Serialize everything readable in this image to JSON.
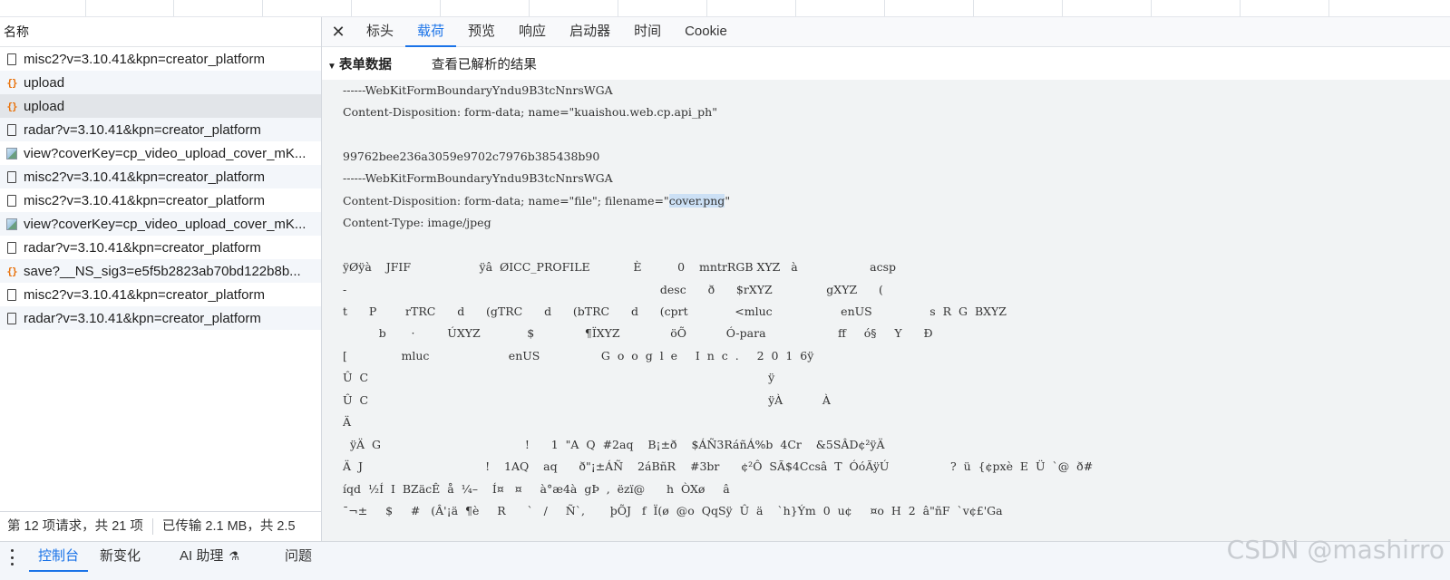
{
  "left": {
    "header": "名称",
    "requests": [
      {
        "icon": "doc",
        "name": "misc2?v=3.10.41&kpn=creator_platform"
      },
      {
        "icon": "xhr",
        "name": "upload"
      },
      {
        "icon": "xhr",
        "name": "upload"
      },
      {
        "icon": "doc",
        "name": "radar?v=3.10.41&kpn=creator_platform"
      },
      {
        "icon": "img",
        "name": "view?coverKey=cp_video_upload_cover_mK..."
      },
      {
        "icon": "doc",
        "name": "misc2?v=3.10.41&kpn=creator_platform"
      },
      {
        "icon": "doc",
        "name": "misc2?v=3.10.41&kpn=creator_platform"
      },
      {
        "icon": "img",
        "name": "view?coverKey=cp_video_upload_cover_mK..."
      },
      {
        "icon": "doc",
        "name": "radar?v=3.10.41&kpn=creator_platform"
      },
      {
        "icon": "xhr",
        "name": "save?__NS_sig3=e5f5b2823ab70bd122b8b..."
      },
      {
        "icon": "doc",
        "name": "misc2?v=3.10.41&kpn=creator_platform"
      },
      {
        "icon": "doc",
        "name": "radar?v=3.10.41&kpn=creator_platform"
      }
    ],
    "status_requests": "第 12 项请求，共 21 项",
    "status_transferred": "已传输 2.1 MB，共 2.5"
  },
  "tabs": {
    "close_symbol": "✕",
    "items": [
      "标头",
      "载荷",
      "预览",
      "响应",
      "启动器",
      "时间",
      "Cookie"
    ],
    "active": "载荷"
  },
  "section": {
    "title": "表单数据",
    "view_parsed": "查看已解析的结果"
  },
  "payload": {
    "boundary": "------WebKitFormBoundaryYndu9B3tcNnrsWGA",
    "disp1": "Content-Disposition: form-data; name=\"kuaishou.web.cp.api_ph\"",
    "value1": "99762bee236a3059e9702c7976b385438b90",
    "disp2_prefix": "Content-Disposition: form-data; name=\"file\"; filename=\"",
    "filename": "cover.png",
    "disp2_suffix": "\"",
    "content_type": "Content-Type: image/jpeg",
    "binary": [
      "ÿØÿà    JFIF                   ÿâ  ØICC_PROFILE            È          0    mntrRGB XYZ   à                    acsp",
      "-                                                                                       desc      ð      $rXYZ               gXYZ      (",
      "t      P        rTRC      d      (gTRC      d      (bTRC      d      (cprt             <mluc                   enUS                s  R  G  BXYZ",
      "          b       ·         ÚXYZ             $              ¶ÏXYZ              öÕ           Ó-para                    ff     ó§     Y      Ð",
      "[               mluc                      enUS                 G  o  o  g  l  e     I  n  c  .     2  0  1  6ÿ",
      "Û  C                                                                                                               ÿ",
      "Û  C                                                                                                               ÿÀ           À",
      "Ä",
      "  ÿÄ  G                                        !      1  \"A  Q  #2aq    B¡±ð    $ÁÑ3RáñÁ%b  4Cr    &5SÂD¢²ÿÄ",
      "Ä  J                                  !    1AQ    aq      ð\"¡±ÁÑ    2áBñR    #3br      ¢²Ô  SÃ$4Ccsâ  T  ÓóÃÿÚ                 ?  ü  {¢pxè  E  Ü  `@  ð#",
      "íqd  ½Í  I  BZäcÊ  å  ¼–    Í¤   ¤     à°æ4à  gÞ  ,  ëzï@      h  ÒXø     â",
      "¯¬±     $     #   (Â'¡ä  ¶è     R      `   /     Ñ`,       þÕJ   f  Ï(ø  @o  QqSÿ  Û  ä    `h}Ým  0  u¢     ¤o  H  2  â\"ñF  `v¢£'Ga"
    ]
  },
  "drawer": {
    "tabs": [
      "控制台",
      "新变化",
      "AI 助理",
      "问题"
    ],
    "active": "控制台",
    "flask_glyph": "⚗",
    "watermark": "CSDN @mashirro"
  }
}
